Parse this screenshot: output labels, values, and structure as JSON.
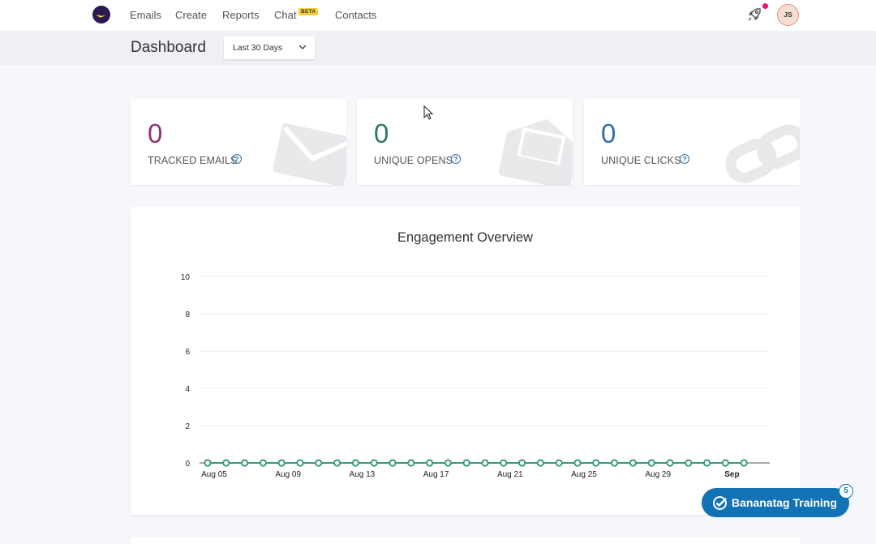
{
  "nav": {
    "links": [
      {
        "label": "Emails"
      },
      {
        "label": "Create"
      },
      {
        "label": "Reports"
      },
      {
        "label": "Chat"
      },
      {
        "label": "Contacts"
      }
    ],
    "chat_badge": "BETA",
    "user_initials": "JS",
    "notification_color": "#e8127c"
  },
  "header": {
    "title": "Dashboard",
    "range_selected": "Last 30 Days"
  },
  "stats": [
    {
      "value": "0",
      "label": "TRACKED EMAILS",
      "color": "#8e3477",
      "icon": "envelope-icon"
    },
    {
      "value": "0",
      "label": "UNIQUE OPENS",
      "color": "#2d7d5a",
      "icon": "open-envelope-icon"
    },
    {
      "value": "0",
      "label": "UNIQUE CLICKS",
      "color": "#2f6fad",
      "icon": "link-icon"
    }
  ],
  "chart": {
    "title": "Engagement Overview"
  },
  "chart_data": {
    "type": "line",
    "title": "Engagement Overview",
    "xlabel": "",
    "ylabel": "",
    "ylim": [
      0,
      10
    ],
    "yticks": [
      "0",
      "2",
      "4",
      "6",
      "8",
      "10"
    ],
    "xticks": [
      "Aug 05",
      "Aug 09",
      "Aug 13",
      "Aug 17",
      "Aug 21",
      "Aug 25",
      "Aug 29",
      "Sep"
    ],
    "x": [
      "Aug 05",
      "Aug 06",
      "Aug 07",
      "Aug 08",
      "Aug 09",
      "Aug 10",
      "Aug 11",
      "Aug 12",
      "Aug 13",
      "Aug 14",
      "Aug 15",
      "Aug 16",
      "Aug 17",
      "Aug 18",
      "Aug 19",
      "Aug 20",
      "Aug 21",
      "Aug 22",
      "Aug 23",
      "Aug 24",
      "Aug 25",
      "Aug 26",
      "Aug 27",
      "Aug 28",
      "Aug 29",
      "Aug 30",
      "Aug 31",
      "Sep 01",
      "Sep 02",
      "Sep 03"
    ],
    "series": [
      {
        "values": [
          0,
          0,
          0,
          0,
          0,
          0,
          0,
          0,
          0,
          0,
          0,
          0,
          0,
          0,
          0,
          0,
          0,
          0,
          0,
          0,
          0,
          0,
          0,
          0,
          0,
          0,
          0,
          0,
          0,
          0
        ],
        "color": "#3d9a73"
      }
    ],
    "grid": true
  },
  "training": {
    "label": "Bananatag Training",
    "count": "5"
  }
}
